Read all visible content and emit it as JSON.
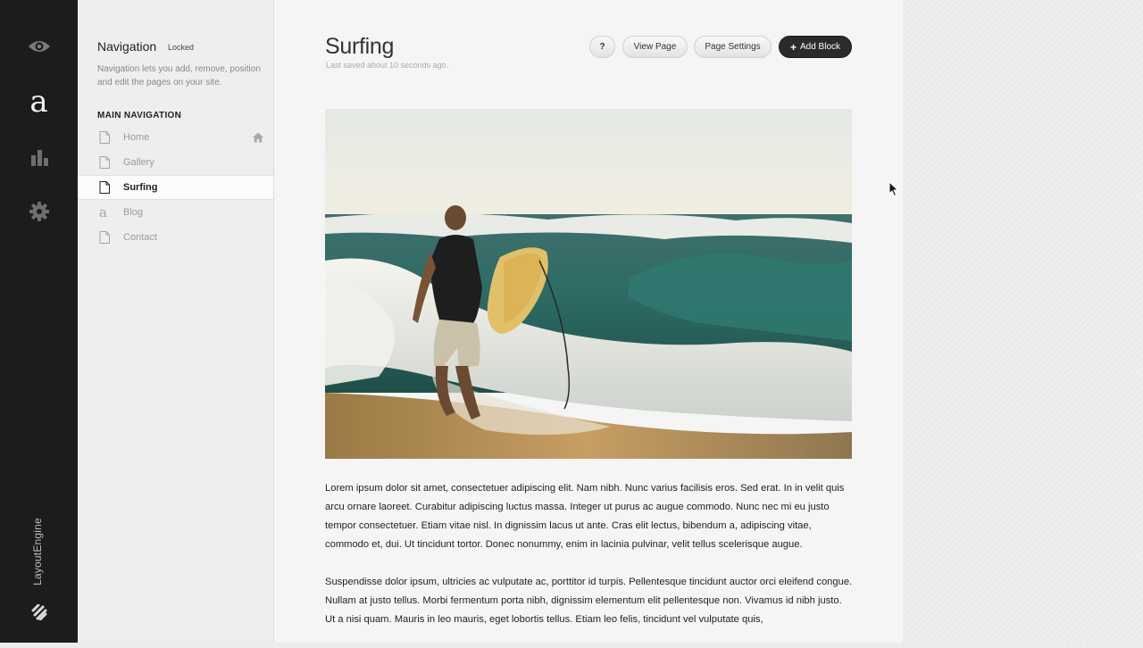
{
  "rail": {
    "icons": [
      "eye-icon",
      "a-letter-logo",
      "bar-chart-icon",
      "gear-icon",
      "squarespace-logo-icon"
    ],
    "brand_letter": "a",
    "engine_label": "LayoutEngine"
  },
  "navigation": {
    "title": "Navigation",
    "locked": "Locked",
    "description": "Navigation lets you add, remove, position and edit the pages on your site.",
    "section": "MAIN NAVIGATION",
    "items": [
      {
        "label": "Home",
        "icon": "page-icon"
      },
      {
        "label": "Gallery",
        "icon": "page-icon"
      },
      {
        "label": "Surfing",
        "icon": "page-icon"
      },
      {
        "label": "Blog",
        "icon": "blog-a-icon"
      },
      {
        "label": "Contact",
        "icon": "page-icon"
      }
    ],
    "active_item": "Surfing"
  },
  "page": {
    "title": "Surfing",
    "saved": "Last saved about 10 seconds ago.",
    "buttons": {
      "help": "?",
      "view": "View Page",
      "settings": "Page Settings",
      "add": "Add Block",
      "add_plus": "+"
    },
    "paragraphs": [
      "Lorem ipsum dolor sit amet, consectetuer adipiscing elit. Nam nibh. Nunc varius facilisis eros. Sed erat. In in velit quis arcu ornare laoreet. Curabitur adipiscing luctus massa. Integer ut purus ac augue commodo. Nunc nec mi eu justo tempor consectetuer. Etiam vitae nisl. In dignissim lacus ut ante. Cras elit lectus, bibendum a, adipiscing vitae, commodo et, dui. Ut tincidunt tortor. Donec nonummy, enim in lacinia pulvinar, velit tellus scelerisque augue.",
      "Suspendisse dolor ipsum, ultricies ac vulputate ac, porttitor id turpis. Pellentesque tincidunt auctor orci eleifend congue. Nullam at justo tellus. Morbi fermentum porta nibh, dignissim elementum elit pellentesque non. Vivamus id nibh justo. Ut a nisi quam. Mauris in leo mauris, eget lobortis tellus. Etiam leo felis, tincidunt vel vulputate quis,"
    ]
  },
  "colors": {
    "rail_bg": "#1c1c1c",
    "accent_button": "#2b2b2b"
  }
}
